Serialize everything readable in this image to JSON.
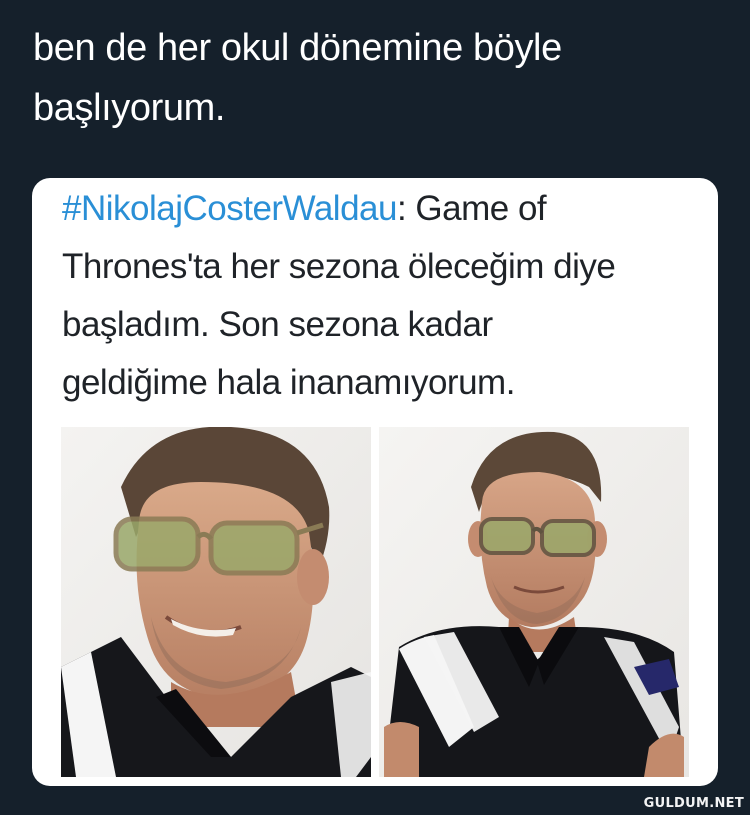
{
  "caption": {
    "line1": "ben de her okul dönemine böyle",
    "line2": "başlıyorum."
  },
  "tweet": {
    "hashtag": "#NikolajCosterWaldau",
    "colon": ":",
    "rest_line1": " Game of",
    "line2": "Thrones'ta her sezona öleceğim diye",
    "line3": "başladım. Son sezona kadar",
    "line4": "geldiğime hala inanamıyorum."
  },
  "images": [
    {
      "name": "photo-left",
      "description_color": "#f1f0ee"
    },
    {
      "name": "photo-right",
      "description_color": "#f1f0ee"
    }
  ],
  "watermark": "GULDUM.NET",
  "colors": {
    "background": "#15202b",
    "card": "#ffffff",
    "hashtag": "#2a8fd6",
    "text": "#1f2328"
  }
}
